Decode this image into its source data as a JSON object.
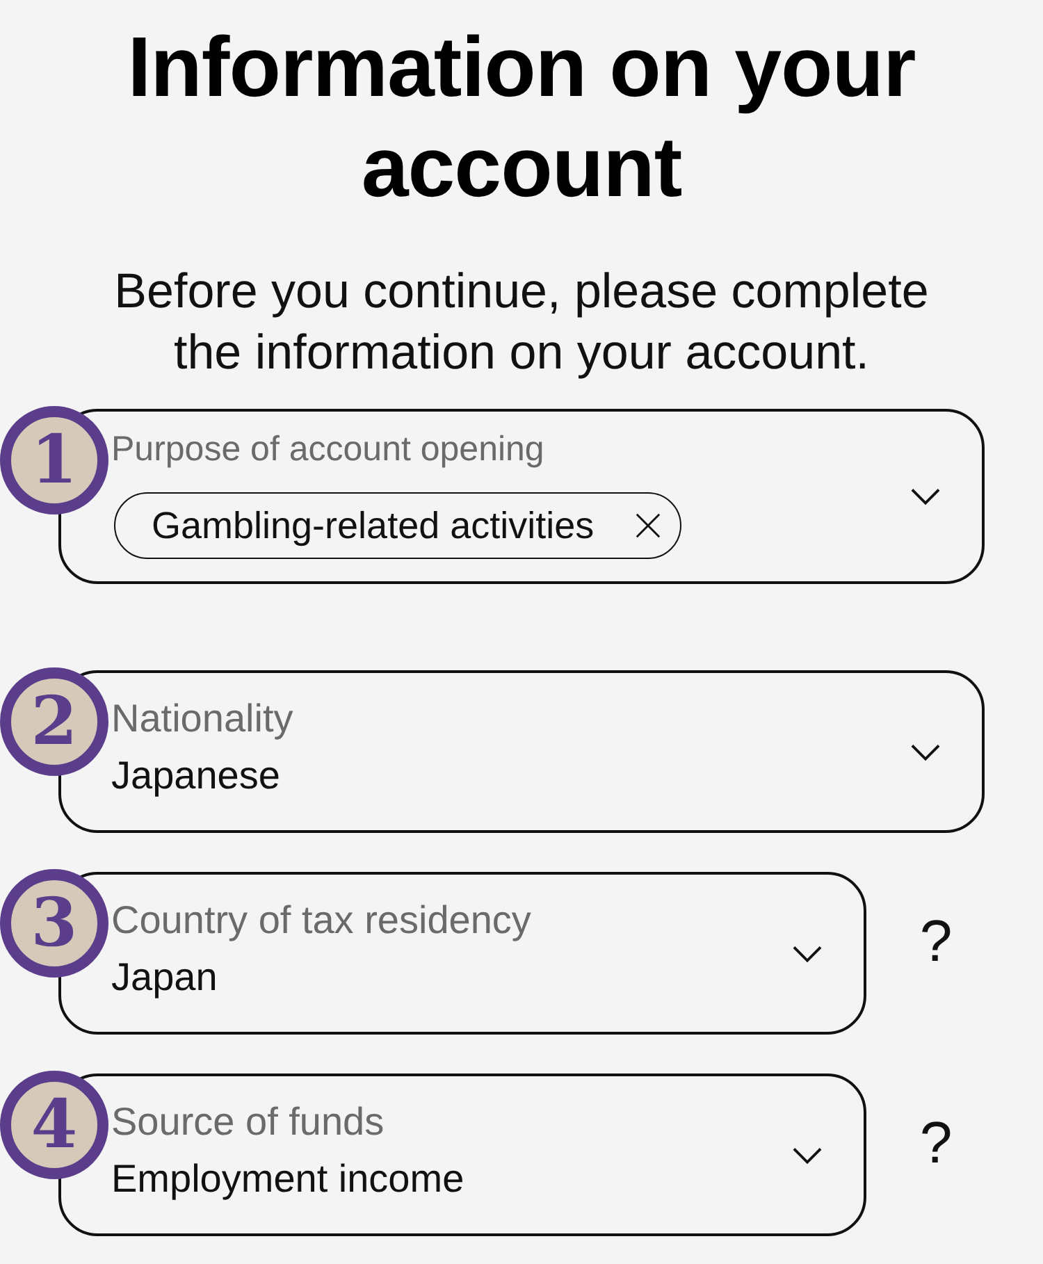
{
  "page": {
    "title": "Information on your account",
    "intro": "Before you continue, please complete the information on your account."
  },
  "fields": [
    {
      "marker": "1",
      "kind": "multi",
      "label": "Purpose of account opening",
      "chips": [
        {
          "label": "Gambling-related activities"
        }
      ]
    },
    {
      "marker": "2",
      "kind": "single",
      "label": "Nationality",
      "value": "Japanese"
    },
    {
      "marker": "3",
      "kind": "single",
      "label": "Country of tax residency",
      "value": "Japan",
      "help": "?"
    },
    {
      "marker": "4",
      "kind": "single",
      "label": "Source of funds",
      "value": "Employment income",
      "help": "?"
    }
  ]
}
